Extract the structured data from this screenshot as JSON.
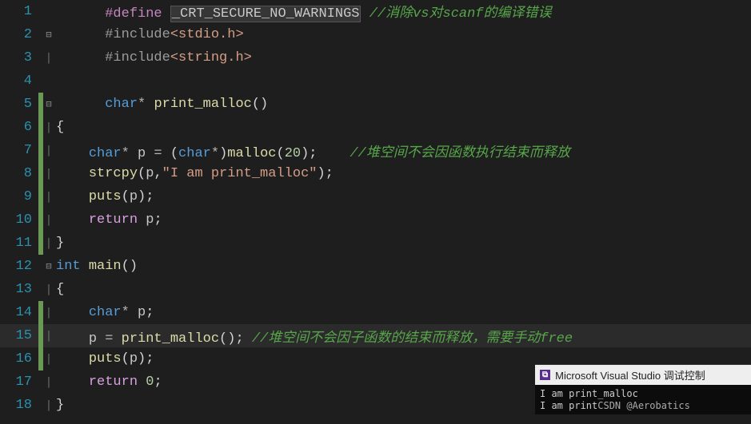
{
  "lines": {
    "l1_define": "#define",
    "l1_macro": "_CRT_SECURE_NO_WARNINGS",
    "l1_comment": "//消除vs对scanf的编译错误",
    "l2_inc": "#include",
    "l2_hdr": "<stdio.h>",
    "l3_inc": "#include",
    "l3_hdr": "<string.h>",
    "l5_type": "char",
    "l5_func": "print_malloc",
    "l6_brace": "{",
    "l7_type": "char",
    "l7_var": "p",
    "l7_cast": "char",
    "l7_call": "malloc",
    "l7_arg": "20",
    "l7_comment": "//堆空间不会因函数执行结束而释放",
    "l8_call": "strcpy",
    "l8_var": "p",
    "l8_str": "\"I am print_malloc\"",
    "l9_call": "puts",
    "l9_var": "p",
    "l10_kw": "return",
    "l10_var": "p",
    "l11_brace": "}",
    "l12_type": "int",
    "l12_func": "main",
    "l13_brace": "{",
    "l14_type": "char",
    "l14_var": "p",
    "l15_var": "p",
    "l15_call": "print_malloc",
    "l15_comment": "//堆空间不会因子函数的结束而释放，需要手动free",
    "l16_call": "puts",
    "l16_var": "p",
    "l17_kw": "return",
    "l17_val": "0",
    "l18_brace": "}"
  },
  "gutter": [
    "1",
    "2",
    "3",
    "4",
    "5",
    "6",
    "7",
    "8",
    "9",
    "10",
    "11",
    "12",
    "13",
    "14",
    "15",
    "16",
    "17",
    "18"
  ],
  "fold": {
    "minus": "⊟",
    "bar": "│"
  },
  "console": {
    "badge": "⧉",
    "title": "Microsoft Visual Studio 调试控制",
    "out1": "I am print_malloc",
    "out2_prefix": "I am print",
    "watermark": "CSDN @Aerobatics"
  }
}
